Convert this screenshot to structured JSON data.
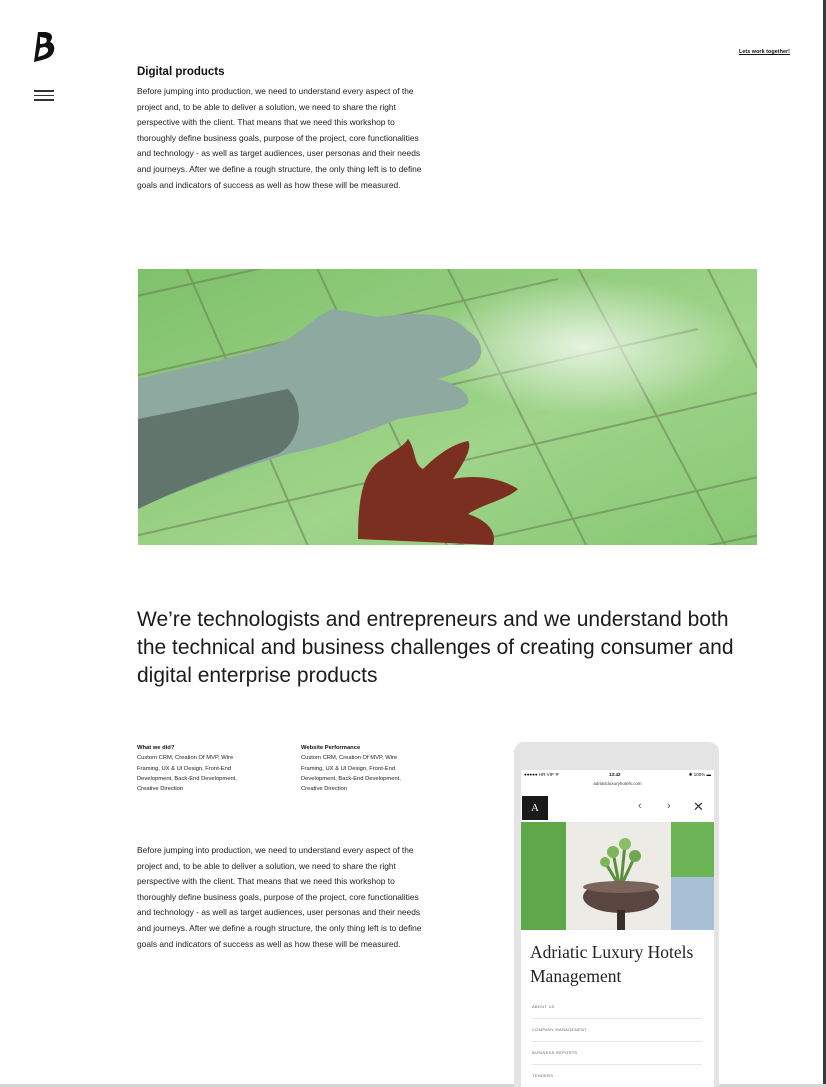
{
  "header": {
    "logo_icon": "brand-b-logo-icon",
    "menu_icon": "hamburger-menu-icon",
    "cta_label": "Lets work together!"
  },
  "intro": {
    "title": "Digital products",
    "body": "Before jumping into production, we need to understand every aspect of the project and, to be able to deliver a solution, we need to share the right perspective with the client. That means that we need this workshop to thoroughly define business goals, purpose of the project, core functionalities and technology - as well as target audiences, user personas and their needs and journeys. After we define a rough structure, the only thing left is to define goals and indicators of success as well as how these will be measured."
  },
  "hero_image": {
    "icon": "hand-over-grid-photo",
    "accent_color": "#8fcb7a"
  },
  "headline": "We’re technologists and entrepreneurs and we understand both the technical and business challenges of creating consumer and digital enterprise products",
  "meta": {
    "col1": {
      "title": "What we did?",
      "body": "Custom CRM, Creation Of MVP, Wire Framing, UX & UI Design, Front-End Development, Back-End Development, Creative Direction"
    },
    "col2": {
      "title": "Website Performance",
      "body": "Custom CRM, Creation Of MVP, Wire Framing, UX & UI Design, Front-End Development, Back-End Development, Creative Direction"
    }
  },
  "details": {
    "body": "Before jumping into production, we need to understand every aspect of the project and, to be able to deliver a solution, we need to share the right perspective with the client. That means that we need this workshop to thoroughly define business goals, purpose of the project, core functionalities and technology - as well as target audiences, user personas and their needs and journeys. After we define a rough structure, the only thing left is to define goals and indicators of success as well as how these will be measured."
  },
  "phone": {
    "status": {
      "carrier": "●●●●● HR VIP ᯤ",
      "time": "13:42",
      "battery": "✱ 100% ▬"
    },
    "url": "adriaticluxuryhotels.com",
    "site_logo": "A",
    "nav_prev": "‹",
    "nav_next": "›",
    "nav_close": "✕",
    "site_title": "Adriatic Luxury Hotels Management",
    "menu": [
      "ABOUT US",
      "COMPANY MANAGEMENT",
      "BUSINESS REPORTS",
      "TENDERS"
    ],
    "photo_icon": "potted-plant-photo"
  }
}
